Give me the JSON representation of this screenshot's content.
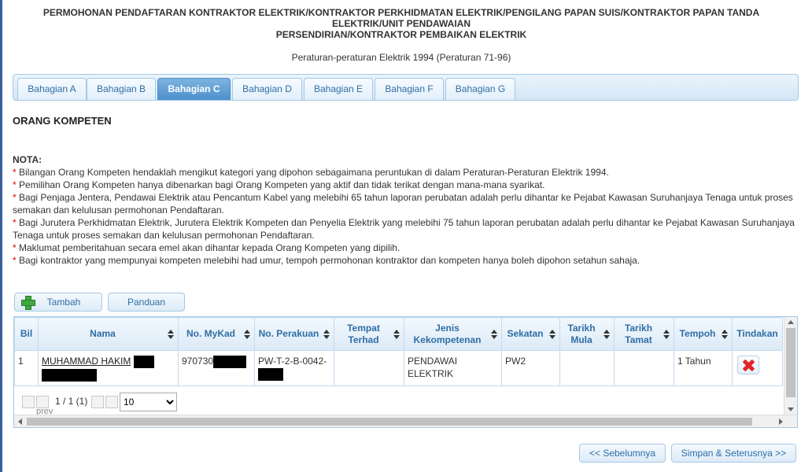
{
  "header": {
    "line1": "PERMOHONAN PENDAFTARAN KONTRAKTOR ELEKTRIK/KONTRAKTOR PERKHIDMATAN ELEKTRIK/PENGILANG PAPAN SUIS/KONTRAKTOR PAPAN TANDA",
    "line2": "ELEKTRIK/UNIT PENDAWAIAN",
    "line3": "PERSENDIRIAN/KONTRAKTOR PEMBAIKAN ELEKTRIK",
    "subtitle": "Peraturan-peraturan Elektrik 1994 (Peraturan 71-96)"
  },
  "tabs": [
    {
      "label": "Bahagian A"
    },
    {
      "label": "Bahagian B"
    },
    {
      "label": "Bahagian C",
      "active": true
    },
    {
      "label": "Bahagian D"
    },
    {
      "label": "Bahagian E"
    },
    {
      "label": "Bahagian F"
    },
    {
      "label": "Bahagian G"
    }
  ],
  "section_title": "ORANG KOMPETEN",
  "notes": {
    "title": "NOTA:",
    "items": [
      "Bilangan Orang Kompeten hendaklah mengikut kategori yang dipohon sebagaimana peruntukan di dalam Peraturan-Peraturan Elektrik 1994.",
      "Pemilihan Orang Kompeten hanya dibenarkan bagi Orang Kompeten yang aktif dan tidak terikat dengan mana-mana syarikat.",
      "Bagi Penjaga Jentera, Pendawai Elektrik atau Pencantum Kabel yang melebihi 65 tahun laporan perubatan adalah perlu dihantar ke Pejabat Kawasan Suruhanjaya Tenaga untuk proses semakan dan kelulusan permohonan Pendaftaran.",
      "Bagi Jurutera Perkhidmatan Elektrik, Jurutera Elektrik Kompeten dan Penyelia Elektrik yang melebihi 75 tahun laporan perubatan adalah perlu dihantar ke Pejabat Kawasan Suruhanjaya Tenaga untuk proses semakan dan kelulusan permohonan Pendaftaran.",
      "Maklumat pemberitahuan secara emel akan dihantar kepada Orang Kompeten yang dipilih.",
      "Bagi kontraktor yang mempunyai kompeten melebihi had umur, tempoh permohonan kontraktor dan kompeten hanya boleh dipohon setahun sahaja."
    ]
  },
  "actions": {
    "add_label": "Tambah",
    "guide_label": "Panduan"
  },
  "grid": {
    "columns": [
      "Bil",
      "Nama",
      "No. MyKad",
      "No. Perakuan",
      "Tempat Terhad",
      "Jenis Kekompetenan",
      "Sekatan",
      "Tarikh Mula",
      "Tarikh Tamat",
      "Tempoh",
      "Tindakan"
    ],
    "rows": [
      {
        "bil": "1",
        "nama": "MUHAMMAD HAKIM",
        "mykad": "970730",
        "perakuan": "PW-T-2-B-0042-",
        "tempat_terhad": "",
        "jenis": "PENDAWAI ELEKTRIK",
        "sekatan": "PW2",
        "tarikh_mula": "",
        "tarikh_tamat": "",
        "tempoh": "1 Tahun"
      }
    ],
    "pager": {
      "prev_label": "prev",
      "count_text": "1 / 1 (1)",
      "page_size_options": [
        "10"
      ],
      "page_size_selected": "10"
    }
  },
  "footer": {
    "prev_label": "<< Sebelumnya",
    "next_label": "Simpan & Seterusnya >>"
  },
  "colors": {
    "accent": "#2f6ea5",
    "active_tab": "#4c8fcb",
    "note_star": "#dd0000",
    "delete_icon": "#e0262b"
  }
}
